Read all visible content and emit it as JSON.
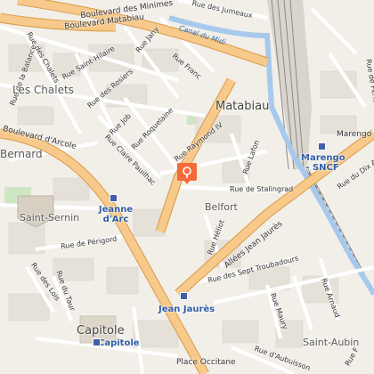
{
  "map": {
    "colors": {
      "background": "#f2efe9",
      "major_road": "#f7b96a",
      "minor_road": "#ffffff",
      "canal": "#a7c9ec",
      "railway": "#8a8a8a",
      "marker": "#f46a3a"
    },
    "labels": {
      "bd_minimes": "Boulevard des Minimes",
      "bd_matabiau": "Boulevard Matabiau",
      "canal_midi": "Canal du Midi",
      "rue_des_jumeaux": "Rue des Jumeaux",
      "rue_jany": "Rue Jany",
      "rue_franc": "Rue Franc",
      "rue_saint_hilaire": "Rue Saint-Hilaire",
      "rue_des_chalets": "Rue des Chalets",
      "rue_des_rosiers": "Rue des Rosiers",
      "rue_de_la_balance": "Rue de la Balance",
      "les_chalets": "Les Chalets",
      "matabiau": "Matabiau",
      "rue_job": "Rue Job",
      "rue_roquelaine": "Rue Roquelaine",
      "rue_claire_pauilhac": "Rue Claire Pauilhac",
      "bd_arcole": "Boulevard d'Arcole",
      "bernard": "Bernard",
      "rue_raymond_iv": "Rue Raymond IV",
      "rue_lafon": "Rue Lafon",
      "rue_de_stalingrad": "Rue de Stalingrad",
      "marengo_sncf": "Marengo - SNCF",
      "marengo": "Marengo",
      "rue_du_dix_avril": "Rue du Dix Avril",
      "rue_de_perole": "Rue de Périole",
      "saint_sernin": "Saint-Sernin",
      "jeanne_darc": "Jeanne d'Arc",
      "belfort": "Belfort",
      "allees_jean_jaures": "Allées Jean Jaurès",
      "rue_de_perigord": "Rue de Périgord",
      "rue_heliot": "Rue Héliot",
      "rue_des_lois": "Rue des Lois",
      "rue_du_taur": "Rue du Taur",
      "rue_des_sept_troubadours": "Rue des Sept Troubadours",
      "jean_jaures": "Jean Jaurès",
      "rue_maury": "Rue Maury",
      "rue_arnaud": "Rue Arnaud",
      "capitole_area": "Capitole",
      "capitole_station": "Capitole",
      "saint_aubin": "Saint-Aubin",
      "place_occitane": "Place Occitane",
      "rue_d_aubuisson": "Rue d'Aubuisson",
      "rue_f": "Rue F"
    },
    "icons": {
      "metro": "metro-station-icon",
      "pin": "location-pin-icon"
    }
  }
}
